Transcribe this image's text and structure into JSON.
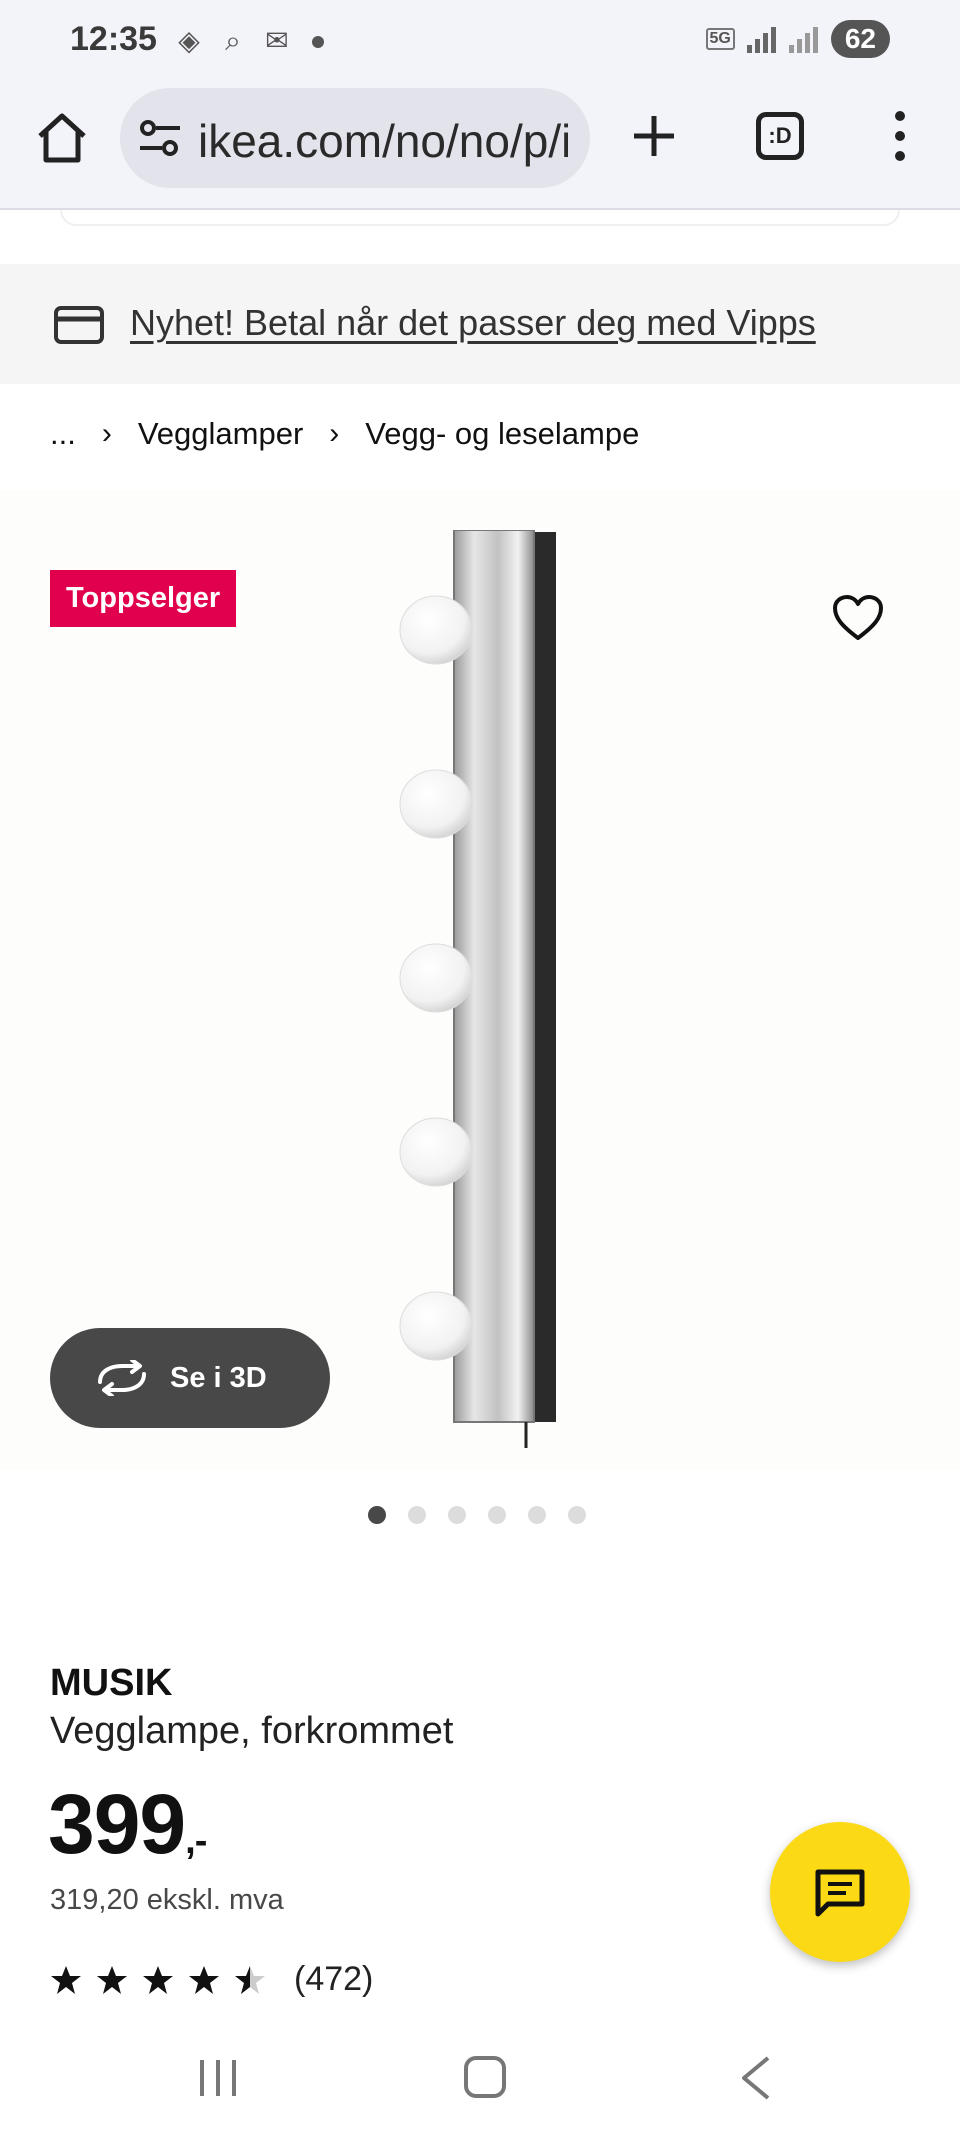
{
  "status_bar": {
    "time": "12:35",
    "network": "5G",
    "battery": "62",
    "icons": [
      "app-icon",
      "search-icon",
      "gmail-icon"
    ]
  },
  "browser": {
    "url": "ikea.com/no/no/p/i",
    "tabs_label": ":D"
  },
  "promo": {
    "text": "Nyhet! Betal når det passer deg med Vipps"
  },
  "breadcrumb": {
    "ellipsis": "...",
    "items": [
      "Vegglamper",
      "Vegg- og leselampe"
    ]
  },
  "gallery": {
    "badge": "Toppselger",
    "see_3d": "Se i 3D",
    "image_count": 6,
    "active_index": 0
  },
  "product": {
    "brand": "MUSIK",
    "description": "Vegglampe, forkrommet",
    "price": "399",
    "price_suffix": ",-",
    "ex_vat": "319,20 ekskl. mva",
    "rating": 4.5,
    "review_count": "(472)"
  },
  "colors": {
    "badge": "#e0004d",
    "chat_button": "#fbd914",
    "see3d_button": "#484848"
  }
}
